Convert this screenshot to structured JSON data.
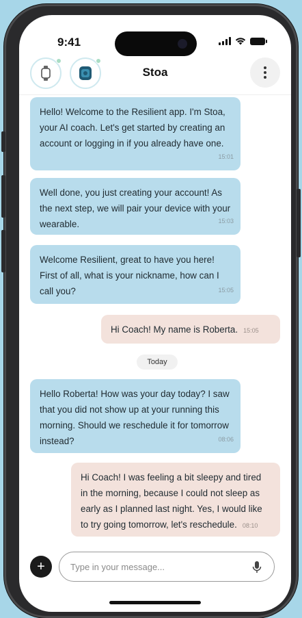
{
  "status_bar": {
    "time": "9:41"
  },
  "header": {
    "title": "Stoa",
    "devices": [
      {
        "icon": "watch-icon",
        "status_color": "#a9dcc4"
      },
      {
        "icon": "ring-device-icon",
        "status_color": "#a9dcc4"
      }
    ],
    "menu_icon": "more-vertical-icon"
  },
  "messages": [
    {
      "sender": "coach",
      "text": "Hello! Welcome to the Resilient app. I'm Stoa, your AI coach. Let's get started by creating an account or logging in if you already have one.",
      "time": "15:01"
    },
    {
      "sender": "coach",
      "text": "Well done, you just creating your account! As the next step, we will pair your device with your wearable.",
      "time": "15:03"
    },
    {
      "sender": "coach",
      "text": "Welcome Resilient, great to have you here! First of all, what is your nickname, how can I call you?",
      "time": "15:05"
    },
    {
      "sender": "user",
      "text": "Hi Coach! My name is Roberta.",
      "time": "15:05"
    },
    {
      "sender": "coach",
      "text": "Hello Roberta! How was your day today? I saw that you did not show up at your running this morning. Should we reschedule it for tomorrow instead?",
      "time": "08:06"
    },
    {
      "sender": "user",
      "text": "Hi Coach! I was feeling a bit sleepy and tired in the morning, because I could not sleep as early as I planned last night. Yes, I would like to try going tomorrow, let's reschedule.",
      "time": "08:10"
    }
  ],
  "divider": {
    "label": "Today"
  },
  "composer": {
    "placeholder": "Type in your message...",
    "value": "",
    "add_icon": "plus-icon",
    "mic_icon": "microphone-icon"
  },
  "colors": {
    "coach_bubble": "#b8dcec",
    "user_bubble": "#f3e2dc",
    "background": "#a7d6e8"
  }
}
